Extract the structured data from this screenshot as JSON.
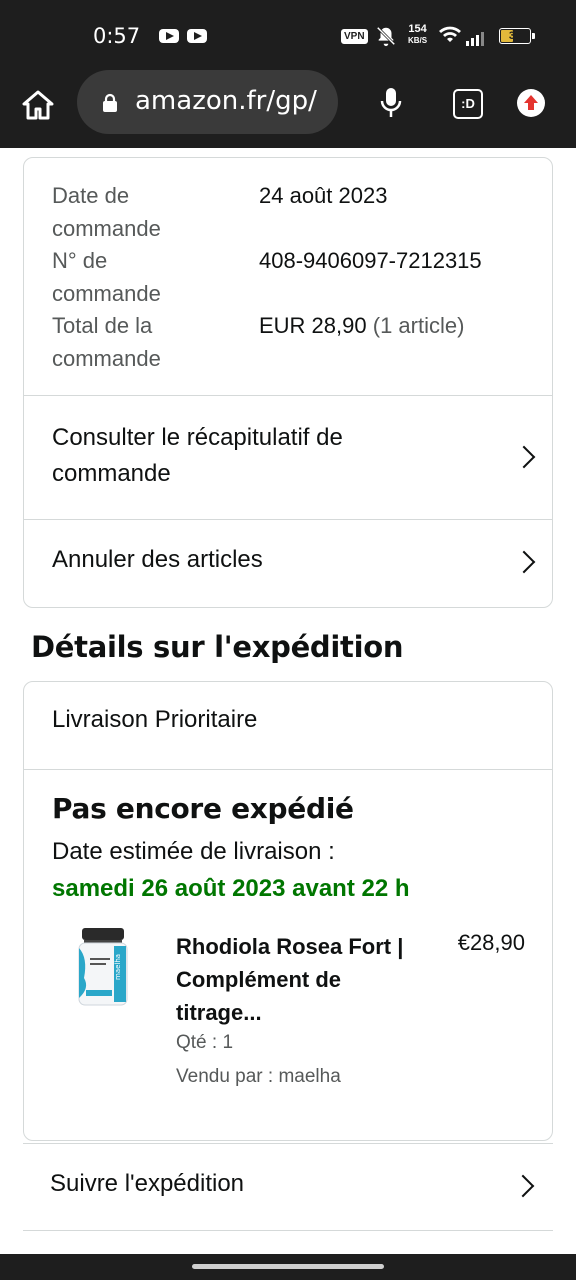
{
  "status_bar": {
    "time": "0:57",
    "vpn": "VPN",
    "speed_value": "154",
    "speed_unit": "KB/S",
    "battery": "39"
  },
  "browser": {
    "url": "amazon.fr/gp/",
    "tabs_label": ":D"
  },
  "order_summary": {
    "rows": [
      {
        "label": "Date de commande",
        "value": "24 août 2023"
      },
      {
        "label": "N° de commande",
        "value": "408-9406097-7212315"
      },
      {
        "label": "Total de la commande",
        "value": "EUR 28,90",
        "extra": "(1 article)"
      }
    ],
    "view_summary": "Consulter le récapitulatif de commande",
    "cancel_items": "Annuler des articles"
  },
  "shipment": {
    "section_title": "Détails sur l'expédition",
    "method": "Livraison Prioritaire",
    "status": "Pas encore expédié",
    "estimated_label": "Date estimée de livraison :",
    "estimated_date": "samedi 26 août 2023 avant 22 h",
    "product": {
      "title": "Rhodiola Rosea Fort | Complément de titrage...",
      "price": "€28,90",
      "quantity": "Qté : 1",
      "seller": "Vendu par : maelha",
      "image_label": "maelha"
    },
    "track": "Suivre l'expédition"
  },
  "colors": {
    "delivery_green": "#007600",
    "border": "#d5d9d9",
    "browser_bg": "#1e1e1e"
  }
}
